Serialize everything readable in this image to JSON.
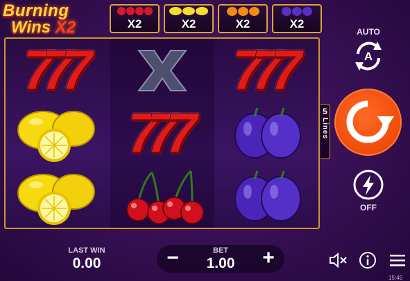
{
  "logo": {
    "line1": "Burning",
    "line2_word": "Wins",
    "line2_mult": "X2"
  },
  "multipliers": [
    {
      "label": "X2",
      "fruit": "cherry",
      "color": "#d8192a"
    },
    {
      "label": "X2",
      "fruit": "lemon",
      "color": "#f4de2a"
    },
    {
      "label": "X2",
      "fruit": "orange",
      "color": "#f28a14"
    },
    {
      "label": "X2",
      "fruit": "plum",
      "color": "#5a2fc4"
    }
  ],
  "reels": [
    [
      "seven",
      "lemon",
      "lemon"
    ],
    [
      "x-symbol",
      "seven",
      "cherry"
    ],
    [
      "seven",
      "plum",
      "plum"
    ]
  ],
  "paylines": {
    "count": "5",
    "label": "Lines"
  },
  "auto": {
    "label": "AUTO",
    "letter": "A"
  },
  "turbo": {
    "label": "OFF"
  },
  "last_win": {
    "label": "LAST WIN",
    "value": "0.00"
  },
  "bet": {
    "label": "BET",
    "value": "1.00",
    "minus": "−",
    "plus": "+"
  },
  "icons": [
    "sound-muted-icon",
    "info-icon",
    "menu-icon",
    "spin-icon",
    "autoplay-icon",
    "turbo-lightning-icon"
  ],
  "clock": "15:45",
  "colors": {
    "frame": "#c9962f",
    "spin": "#f04a08",
    "seven": "#e01b1b"
  }
}
